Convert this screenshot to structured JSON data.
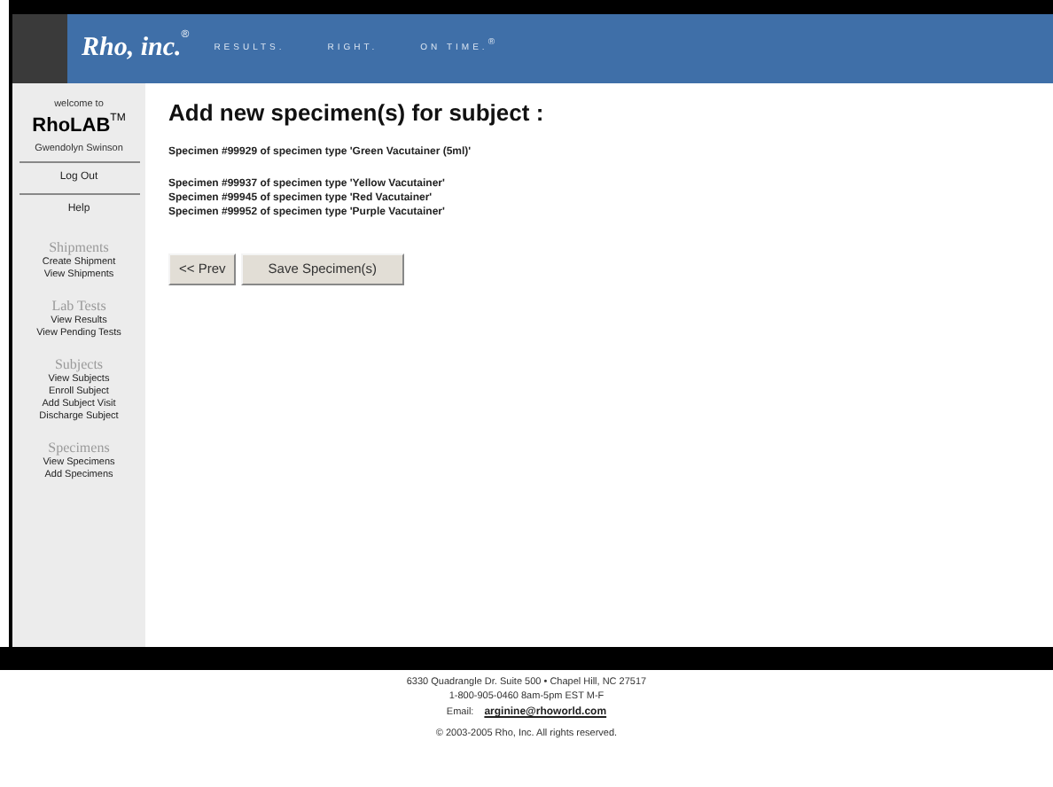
{
  "header": {
    "logo": "Rho, inc.",
    "logo_mark": "®",
    "tagline": [
      "RESULTS.",
      "RIGHT.",
      "ON TIME."
    ],
    "tagline_mark": "®"
  },
  "sidebar": {
    "welcome": "welcome to",
    "app_name": "RhoLAB",
    "app_mark": "TM",
    "user": "Gwendolyn Swinson",
    "links": [
      "Log Out",
      "Help"
    ],
    "sections": [
      {
        "title": "Shipments",
        "items": [
          "Create Shipment",
          "View Shipments"
        ]
      },
      {
        "title": "Lab Tests",
        "items": [
          "View Results",
          "View Pending Tests"
        ]
      },
      {
        "title": "Subjects",
        "items": [
          "View Subjects",
          "Enroll Subject",
          "Add Subject Visit",
          "Discharge Subject"
        ]
      },
      {
        "title": "Specimens",
        "items": [
          "View Specimens",
          "Add Specimens"
        ]
      }
    ]
  },
  "main": {
    "title": "Add new specimen(s) for subject :",
    "specimen_groups": [
      [
        "Specimen #99929 of specimen type 'Green Vacutainer (5ml)'"
      ],
      [
        "Specimen #99937 of specimen type 'Yellow Vacutainer'",
        "Specimen #99945 of specimen type 'Red Vacutainer'",
        "Specimen #99952 of specimen type 'Purple Vacutainer'"
      ]
    ],
    "buttons": [
      "<< Prev",
      "Save Specimen(s)"
    ]
  },
  "footer": {
    "address": "6330 Quadrangle Dr. Suite 500 • Chapel Hill, NC 27517",
    "phone": "1-800-905-0460 8am-5pm EST M-F",
    "email_label": "Email:",
    "email": "arginine@rhoworld.com",
    "copyright": "© 2003-2005 Rho, Inc. All rights reserved."
  }
}
